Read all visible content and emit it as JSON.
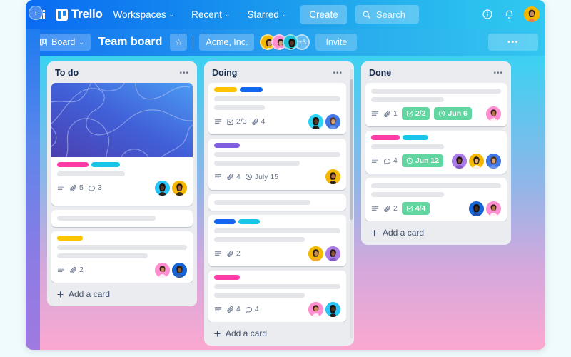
{
  "app": {
    "brand": "Trello"
  },
  "topnav": {
    "grid_icon": "apps-grid-icon",
    "items": [
      {
        "label": "Workspaces",
        "caret": "⌄"
      },
      {
        "label": "Recent",
        "caret": "⌄"
      },
      {
        "label": "Starred",
        "caret": "⌄"
      }
    ],
    "create_label": "Create",
    "search": {
      "placeholder": "Search",
      "icon": "search-icon"
    },
    "info_icon": "info-circle-icon",
    "bell_icon": "notification-bell-icon",
    "avatar": "user-avatar"
  },
  "boardbar": {
    "view_label": "Board",
    "view_caret": "⌄",
    "title": "Team board",
    "star_icon": "☆",
    "workspace": "Acme, Inc.",
    "members_overflow": "+3",
    "invite_label": "Invite",
    "more_label": "•••"
  },
  "rail": {
    "toggle_icon": "›"
  },
  "lists": [
    {
      "title": "To do",
      "menu": "•••",
      "add_card": "Add a card",
      "cards": [
        {
          "cover": true,
          "labels": [
            "#ff3ba7",
            "#18c5e8"
          ],
          "lines": [
            52
          ],
          "meta": [
            {
              "type": "icon",
              "icon": "description-icon"
            },
            {
              "type": "count",
              "icon": "attachment-icon",
              "value": "5"
            },
            {
              "type": "count",
              "icon": "comment-icon",
              "value": "3"
            }
          ],
          "avatars": [
            "#29c5f6",
            "#f5b800"
          ]
        },
        {
          "labels": [],
          "lines": [
            76
          ],
          "meta": [],
          "avatars": []
        },
        {
          "labels": [
            "#ffc400"
          ],
          "lines": [
            100,
            70
          ],
          "meta": [
            {
              "type": "icon",
              "icon": "description-icon"
            },
            {
              "type": "count",
              "icon": "attachment-icon",
              "value": "2"
            }
          ],
          "avatars": [
            "#ff8fd0",
            "#1565d8"
          ]
        }
      ]
    },
    {
      "title": "Doing",
      "menu": "•••",
      "add_card": "Add a card",
      "scrollable": true,
      "cards": [
        {
          "labels": [
            "#ffc400",
            "#1565f0"
          ],
          "lines": [
            100,
            40
          ],
          "meta": [
            {
              "type": "icon",
              "icon": "description-icon"
            },
            {
              "type": "count",
              "icon": "checklist-icon",
              "value": "2/3"
            },
            {
              "type": "count",
              "icon": "attachment-icon",
              "value": "4"
            }
          ],
          "avatars": [
            "#2bd4f5",
            "#3f77e8"
          ]
        },
        {
          "labels": [
            "#7f5fe0"
          ],
          "lines": [
            100,
            68
          ],
          "meta": [
            {
              "type": "icon",
              "icon": "description-icon"
            },
            {
              "type": "count",
              "icon": "attachment-icon",
              "value": "4"
            },
            {
              "type": "count",
              "icon": "clock-icon",
              "value": "July 15"
            }
          ],
          "avatars": [
            "#f5b800"
          ]
        },
        {
          "labels": [],
          "lines": [
            76
          ],
          "meta": [],
          "avatars": []
        },
        {
          "labels": [
            "#1565f0",
            "#18c5e8"
          ],
          "lines": [
            100,
            72
          ],
          "meta": [
            {
              "type": "icon",
              "icon": "description-icon"
            },
            {
              "type": "count",
              "icon": "attachment-icon",
              "value": "2"
            }
          ],
          "avatars": [
            "#f5b800",
            "#a97ae8"
          ]
        },
        {
          "labels": [
            "#ff3ba7"
          ],
          "lines": [
            100,
            72
          ],
          "meta": [
            {
              "type": "icon",
              "icon": "description-icon"
            },
            {
              "type": "count",
              "icon": "attachment-icon",
              "value": "4"
            },
            {
              "type": "count",
              "icon": "comment-icon",
              "value": "4"
            }
          ],
          "avatars": [
            "#ff8fd0",
            "#29c5f6"
          ]
        }
      ]
    },
    {
      "title": "Done",
      "menu": "•••",
      "add_card": "Add a card",
      "cards": [
        {
          "labels": [],
          "lines": [
            100,
            56
          ],
          "meta": [
            {
              "type": "icon",
              "icon": "description-icon"
            },
            {
              "type": "count",
              "icon": "attachment-icon",
              "value": "1"
            },
            {
              "type": "badge",
              "icon": "checklist-icon",
              "value": "2/2"
            },
            {
              "type": "badge",
              "icon": "clock-icon",
              "value": "Jun 6"
            }
          ],
          "avatars": [
            "#ff8fd0"
          ]
        },
        {
          "labels": [
            "#ff3ba7",
            "#18c5e8"
          ],
          "lines": [
            100,
            56
          ],
          "meta": [
            {
              "type": "icon",
              "icon": "description-icon"
            },
            {
              "type": "count",
              "icon": "comment-icon",
              "value": "4"
            },
            {
              "type": "badge",
              "icon": "clock-icon",
              "value": "Jun 12"
            }
          ],
          "avatars": [
            "#a97ae8",
            "#f5b800",
            "#3f77e8"
          ]
        },
        {
          "labels": [],
          "lines": [
            100,
            56
          ],
          "meta": [
            {
              "type": "icon",
              "icon": "description-icon"
            },
            {
              "type": "count",
              "icon": "attachment-icon",
              "value": "2"
            },
            {
              "type": "badge",
              "icon": "checklist-icon",
              "value": "4/4"
            }
          ],
          "avatars": [
            "#1565d8",
            "#ff8fd0"
          ]
        }
      ]
    }
  ],
  "colors": {
    "brand_blue": "#0b6bf2",
    "board_top": "#2cc4f0",
    "board_bottom": "#fba8d0",
    "list_bg": "#ebecf0",
    "badge_green": "#61d6a0"
  }
}
